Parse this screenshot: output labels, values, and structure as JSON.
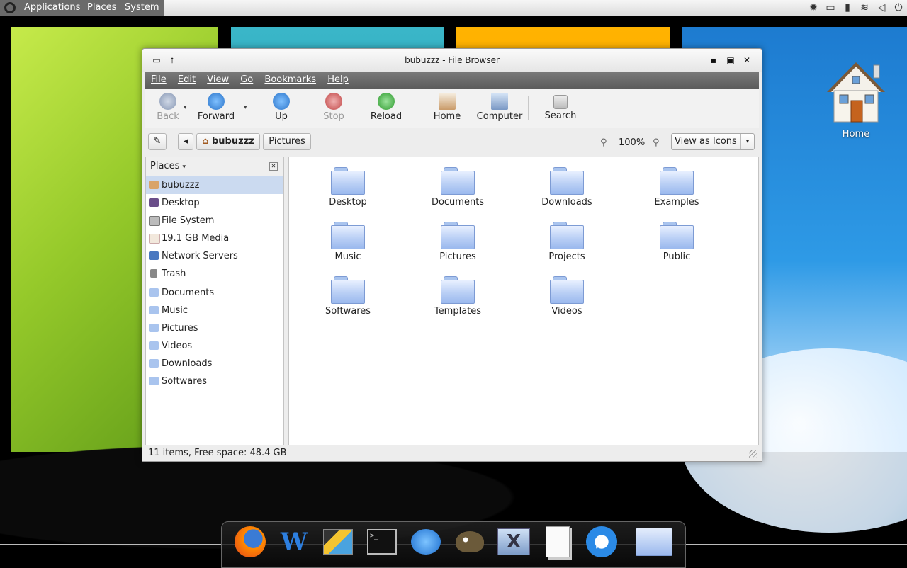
{
  "panel": {
    "menus": [
      "Applications",
      "Places",
      "System"
    ]
  },
  "desktop": {
    "home_label": "Home"
  },
  "window": {
    "title": "bubuzzz - File Browser",
    "menubar": [
      "File",
      "Edit",
      "View",
      "Go",
      "Bookmarks",
      "Help"
    ],
    "toolbar": {
      "back": "Back",
      "forward": "Forward",
      "up": "Up",
      "stop": "Stop",
      "reload": "Reload",
      "home": "Home",
      "computer": "Computer",
      "search": "Search"
    },
    "location": {
      "crumbs": [
        "bubuzzz",
        "Pictures"
      ],
      "zoom": "100%",
      "view_mode": "View as Icons"
    },
    "sidebar": {
      "header": "Places",
      "items": [
        {
          "label": "bubuzzz",
          "icon": "home-icon"
        },
        {
          "label": "Desktop",
          "icon": "desktop-icon"
        },
        {
          "label": "File System",
          "icon": "drive-icon"
        },
        {
          "label": "19.1 GB Media",
          "icon": "usb-drive-icon"
        },
        {
          "label": "Network Servers",
          "icon": "network-icon"
        },
        {
          "label": "Trash",
          "icon": "trash-icon"
        }
      ],
      "bookmarks": [
        "Documents",
        "Music",
        "Pictures",
        "Videos",
        "Downloads",
        "Softwares"
      ]
    },
    "files": [
      "Desktop",
      "Documents",
      "Downloads",
      "Examples",
      "Music",
      "Pictures",
      "Projects",
      "Public",
      "Softwares",
      "Templates",
      "Videos"
    ],
    "status": "11 items, Free space: 48.4 GB"
  },
  "dock": {
    "items": [
      "firefox-icon",
      "writer-icon",
      "video-editor-icon",
      "terminal-icon",
      "video-chat-icon",
      "gimp-icon",
      "computer-icon",
      "text-editor-icon",
      "media-player-icon",
      "folder-icon"
    ]
  },
  "colors": {
    "selection": "#cbdaf0",
    "menubar": "#6a6a6a",
    "folder": "#b9cff5"
  }
}
